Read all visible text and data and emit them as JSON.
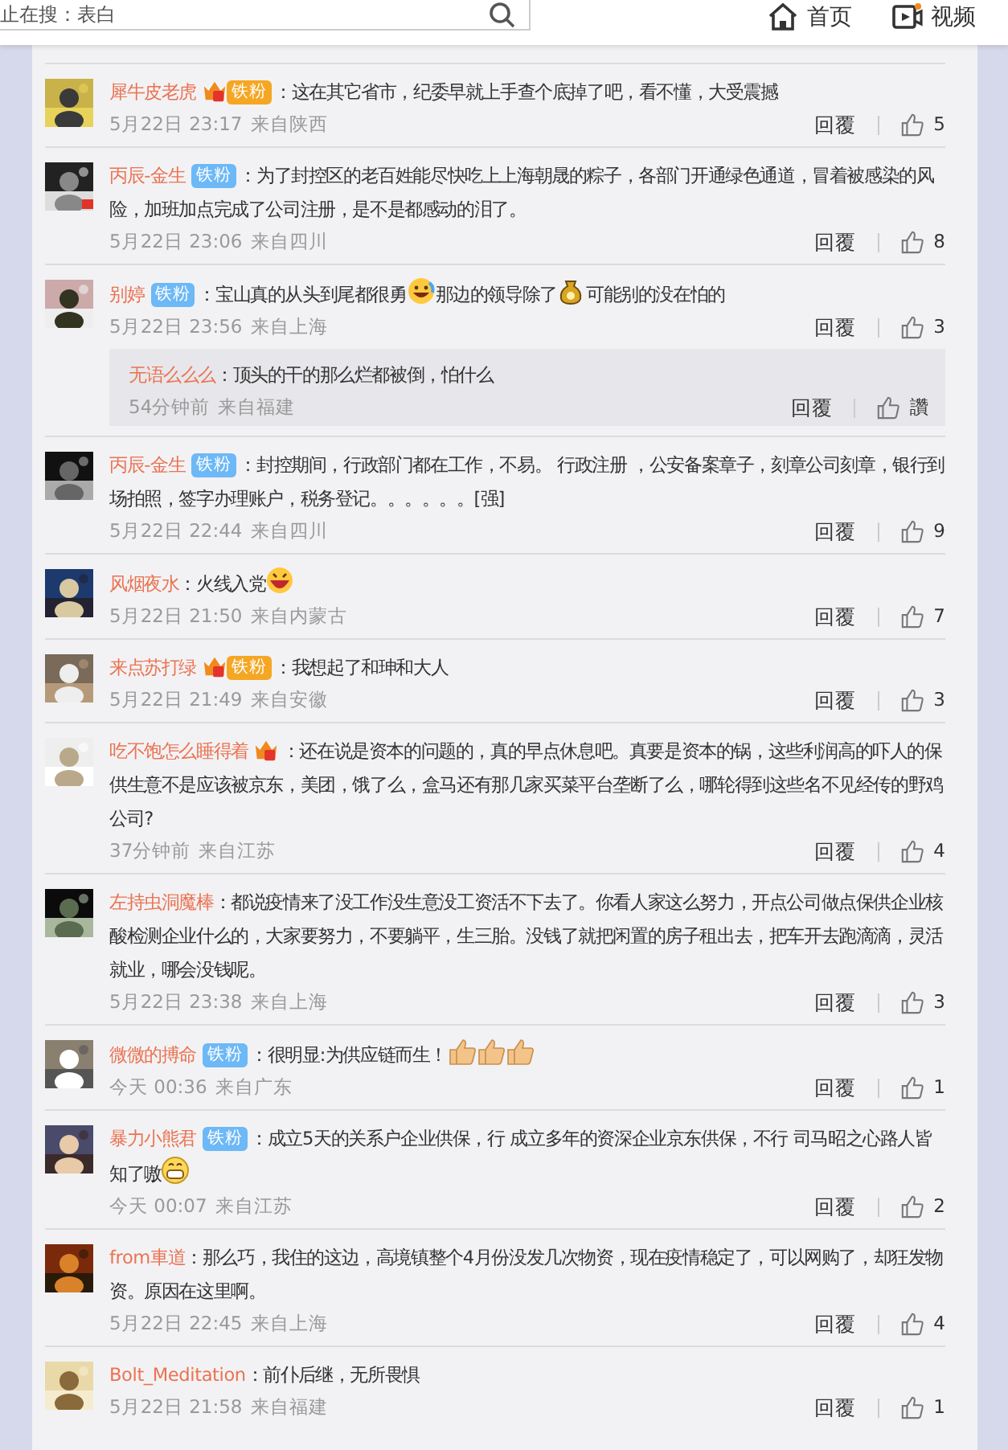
{
  "header": {
    "search": {
      "value": "止在搜：表白"
    },
    "nav": [
      {
        "kind": "home",
        "label": "首页"
      },
      {
        "kind": "video",
        "label": "视频"
      }
    ]
  },
  "comments": [
    {
      "separator": "：",
      "user": "犀牛皮老虎",
      "badge": {
        "kind": "crown",
        "text": "铁粉"
      },
      "parts": [
        {
          "kind": "text",
          "text": "这在其它省市，纪委早就上手查个底掉了吧，看不懂，大受震撼"
        }
      ],
      "time": "5月22日 23:17",
      "location": "来自陕西",
      "reply_label": "回覆",
      "likes": "5"
    },
    {
      "separator": "：",
      "user": "丙辰-金生",
      "badge": {
        "kind": "plain",
        "text": "铁粉"
      },
      "parts": [
        {
          "kind": "text",
          "text": "为了封控区的老百姓能尽快吃上上海朝晟的粽子，各部门开通绿色通道，冒着被感染的风险，加班加点完成了公司注册，是不是都感动的泪了。"
        }
      ],
      "time": "5月22日 23:06",
      "location": "来自四川",
      "reply_label": "回覆",
      "likes": "8"
    },
    {
      "separator": "：",
      "user": "别婷",
      "badge": {
        "kind": "plain",
        "text": "铁粉"
      },
      "parts": [
        {
          "kind": "text",
          "text": "宝山真的从头到尾都很勇"
        },
        {
          "kind": "laugh"
        },
        {
          "kind": "text",
          "text": "那边的领导除了"
        },
        {
          "kind": "moneybag"
        },
        {
          "kind": "text",
          "text": "可能别的没在怕的"
        }
      ],
      "time": "5月22日 23:56",
      "location": "来自上海",
      "reply_label": "回覆",
      "likes": "3",
      "replies": [
        {
          "separator": "：",
          "user": "无语么么么",
          "parts": [
            {
              "kind": "text",
              "text": "顶头的干的那么烂都被倒，怕什么"
            }
          ],
          "time": "54分钟前",
          "location": "来自福建",
          "reply_label": "回覆",
          "likes": "讚"
        }
      ]
    },
    {
      "separator": "：",
      "user": "丙辰-金生",
      "badge": {
        "kind": "plain",
        "text": "铁粉"
      },
      "parts": [
        {
          "kind": "text",
          "text": "封控期间，行政部门都在工作，不易。 行政注册 ，公安备案章子，刻章公司刻章，银行到场拍照，签字办理账户，税务登记。。。。。。[强]"
        }
      ],
      "time": "5月22日 22:44",
      "location": "来自四川",
      "reply_label": "回覆",
      "likes": "9"
    },
    {
      "separator": "：",
      "user": "风烟夜水",
      "parts": [
        {
          "kind": "text",
          "text": "火线入党"
        },
        {
          "kind": "grin"
        }
      ],
      "time": "5月22日 21:50",
      "location": "来自内蒙古",
      "reply_label": "回覆",
      "likes": "7"
    },
    {
      "separator": "：",
      "user": "来点苏打绿",
      "badge": {
        "kind": "crown",
        "text": "铁粉"
      },
      "parts": [
        {
          "kind": "text",
          "text": "我想起了和珅和大人"
        }
      ],
      "time": "5月22日 21:49",
      "location": "来自安徽",
      "reply_label": "回覆",
      "likes": "3"
    },
    {
      "separator": "：",
      "user": "吃不饱怎么睡得着",
      "badge": {
        "kind": "crown-only"
      },
      "parts": [
        {
          "kind": "text",
          "text": "还在说是资本的问题的，真的早点休息吧。真要是资本的锅，这些利润高的吓人的保供生意不是应该被京东，美团，饿了么，盒马还有那几家买菜平台垄断了么，哪轮得到这些名不见经传的野鸡公司?"
        }
      ],
      "time": "37分钟前",
      "location": "来自江苏",
      "reply_label": "回覆",
      "likes": "4"
    },
    {
      "separator": "：",
      "user": "左持虫洞魔棒",
      "parts": [
        {
          "kind": "text",
          "text": "都说疫情来了没工作没生意没工资活不下去了。你看人家这么努力，开点公司做点保供企业核酸检测企业什么的，大家要努力，不要躺平，生三胎。没钱了就把闲置的房子租出去，把车开去跑滴滴，灵活就业，哪会没钱呢。"
        }
      ],
      "time": "5月22日 23:38",
      "location": "来自上海",
      "reply_label": "回覆",
      "likes": "3"
    },
    {
      "separator": "：",
      "user": "微微的搏命",
      "badge": {
        "kind": "plain",
        "text": "铁粉"
      },
      "parts": [
        {
          "kind": "text",
          "text": "很明显:为供应链而生！"
        },
        {
          "kind": "thumbs"
        },
        {
          "kind": "thumbs"
        },
        {
          "kind": "thumbs"
        }
      ],
      "time": "今天 00:36",
      "location": "来自广东",
      "reply_label": "回覆",
      "likes": "1"
    },
    {
      "separator": "：",
      "user": "暴力小熊君",
      "badge": {
        "kind": "plain",
        "text": "铁粉"
      },
      "parts": [
        {
          "kind": "text",
          "text": "成立5天的关系户企业供保，行 成立多年的资深企业京东供保，不行 司马昭之心路人皆知了嗷"
        },
        {
          "kind": "smile"
        }
      ],
      "time": "今天 00:07",
      "location": "来自江苏",
      "reply_label": "回覆",
      "likes": "2"
    },
    {
      "separator": "：",
      "user": "from車道",
      "parts": [
        {
          "kind": "text",
          "text": "那么巧，我住的这边，高境镇整个4月份没发几次物资，现在疫情稳定了，可以网购了，却狂发物资。原因在这里啊。"
        }
      ],
      "time": "5月22日 22:45",
      "location": "来自上海",
      "reply_label": "回覆",
      "likes": "4"
    },
    {
      "separator": "：",
      "user": "Bolt_Meditation",
      "parts": [
        {
          "kind": "text",
          "text": "前仆后继，无所畏惧"
        }
      ],
      "time": "5月22日 21:58",
      "location": "来自福建",
      "reply_label": "回覆",
      "likes": "1"
    }
  ]
}
